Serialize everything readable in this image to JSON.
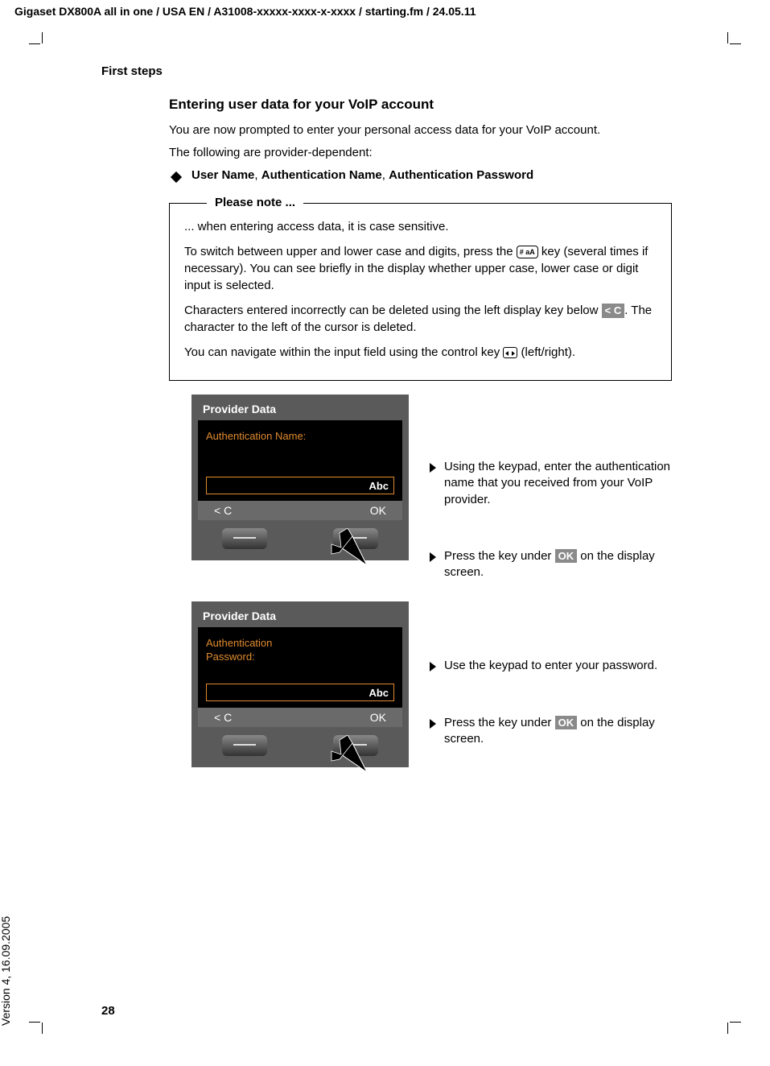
{
  "top_header": "Gigaset DX800A all in one / USA EN / A31008-xxxxx-xxxx-x-xxxx / starting.fm / 24.05.11",
  "section": "First steps",
  "subhead": "Entering user data for your VoIP account",
  "intro_1": "You are now prompted to enter your personal access data for your VoIP account.",
  "intro_2": "The following are provider-dependent:",
  "bullet_1_prefix": "User Name",
  "bullet_1_sep1": ", ",
  "bullet_1_b": "Authentication Name",
  "bullet_1_sep2": ", ",
  "bullet_1_c": "Authentication Password",
  "note_legend": "Please note ...",
  "note_p1": "... when entering access data, it is case sensitive.",
  "note_p2a": "To switch between upper and lower case and digits, press the ",
  "note_p2_key": "# aA",
  "note_p2b": " key (several times if necessary). You can see briefly in the display whether upper case, lower case or digit input is selected.",
  "note_p3a": "Characters entered incorrectly can be deleted using the left display key below ",
  "note_p3_badge": "< C",
  "note_p3b": ". The character to the left of the cursor is deleted.",
  "note_p4a": "You can navigate within the input field using the control key ",
  "note_p4b": " (left/right).",
  "screen1": {
    "title": "Provider Data",
    "label": "Authentication Name:",
    "mode": "Abc",
    "left_key": "< C",
    "right_key": "OK"
  },
  "screen2": {
    "title": "Provider Data",
    "label_line1": "Authentication",
    "label_line2": "Password:",
    "mode": "Abc",
    "left_key": "< C",
    "right_key": "OK"
  },
  "instr1": "Using the keypad, enter the authentication name that you received from your VoIP provider.",
  "instr2a": "Press the key under ",
  "instr2_badge": "OK",
  "instr2b": " on the display screen.",
  "instr3": "Use the keypad to enter your password.",
  "instr4a": "Press the key under ",
  "instr4_badge": "OK",
  "instr4b": " on the display screen.",
  "page_number": "28",
  "side_version": "Version 4, 16.09.2005"
}
